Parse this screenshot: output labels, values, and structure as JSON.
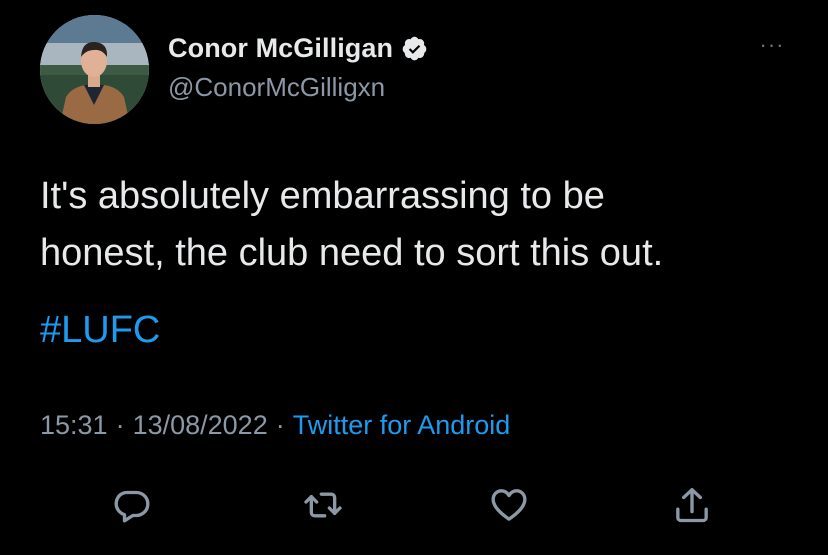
{
  "author": {
    "display_name": "Conor McGilligan",
    "handle": "@ConorMcGilligxn",
    "verified": true,
    "avatar_icon": "profile-photo"
  },
  "tweet": {
    "text_line1": "It's absolutely embarrassing to be",
    "text_line2": "honest, the club need to sort this out.",
    "hashtag": "#LUFC",
    "time": "15:31",
    "separator": "·",
    "date": "13/08/2022",
    "source": "Twitter for Android"
  },
  "actions": [
    {
      "name": "reply",
      "icon": "reply-icon"
    },
    {
      "name": "retweet",
      "icon": "retweet-icon"
    },
    {
      "name": "like",
      "icon": "heart-icon"
    },
    {
      "name": "share",
      "icon": "share-icon"
    }
  ],
  "menu": {
    "more_label": "···"
  },
  "colors": {
    "background": "#000000",
    "text": "#e7e9ea",
    "secondary": "#8b98a5",
    "link": "#1d9bf0"
  }
}
